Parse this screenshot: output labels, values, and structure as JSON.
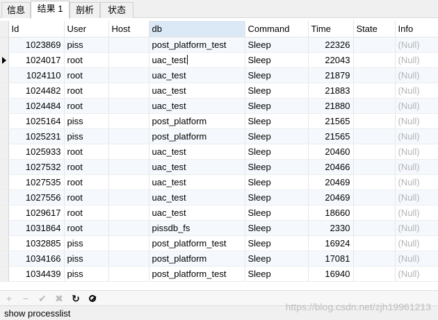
{
  "tabs": [
    {
      "label": "信息",
      "active": false
    },
    {
      "label": "结果 1",
      "active": true
    },
    {
      "label": "剖析",
      "active": false
    },
    {
      "label": "状态",
      "active": false
    }
  ],
  "grid": {
    "columns": [
      "Id",
      "User",
      "Host",
      "db",
      "Command",
      "Time",
      "State",
      "Info"
    ],
    "sorted_column": "db",
    "current_row_index": 1,
    "rows": [
      [
        "1023869",
        "piss",
        "",
        "post_platform_test",
        "Sleep",
        "22326",
        "",
        "(Null)"
      ],
      [
        "1024017",
        "root",
        "",
        "uac_test",
        "Sleep",
        "22043",
        "",
        "(Null)"
      ],
      [
        "1024110",
        "root",
        "",
        "uac_test",
        "Sleep",
        "21879",
        "",
        "(Null)"
      ],
      [
        "1024482",
        "root",
        "",
        "uac_test",
        "Sleep",
        "21883",
        "",
        "(Null)"
      ],
      [
        "1024484",
        "root",
        "",
        "uac_test",
        "Sleep",
        "21880",
        "",
        "(Null)"
      ],
      [
        "1025164",
        "piss",
        "",
        "post_platform",
        "Sleep",
        "21565",
        "",
        "(Null)"
      ],
      [
        "1025231",
        "piss",
        "",
        "post_platform",
        "Sleep",
        "21565",
        "",
        "(Null)"
      ],
      [
        "1025933",
        "root",
        "",
        "uac_test",
        "Sleep",
        "20460",
        "",
        "(Null)"
      ],
      [
        "1027532",
        "root",
        "",
        "uac_test",
        "Sleep",
        "20466",
        "",
        "(Null)"
      ],
      [
        "1027535",
        "root",
        "",
        "uac_test",
        "Sleep",
        "20469",
        "",
        "(Null)"
      ],
      [
        "1027556",
        "root",
        "",
        "uac_test",
        "Sleep",
        "20469",
        "",
        "(Null)"
      ],
      [
        "1029617",
        "root",
        "",
        "uac_test",
        "Sleep",
        "18660",
        "",
        "(Null)"
      ],
      [
        "1031864",
        "root",
        "",
        "pissdb_fs",
        "Sleep",
        "2330",
        "",
        "(Null)"
      ],
      [
        "1032885",
        "piss",
        "",
        "post_platform_test",
        "Sleep",
        "16924",
        "",
        "(Null)"
      ],
      [
        "1034166",
        "piss",
        "",
        "post_platform",
        "Sleep",
        "17081",
        "",
        "(Null)"
      ],
      [
        "1034439",
        "piss",
        "",
        "post_platform_test",
        "Sleep",
        "16940",
        "",
        "(Null)"
      ]
    ]
  },
  "toolbar": {
    "add": "+",
    "remove": "−",
    "apply": "✔",
    "discard": "✖",
    "refresh": "↻"
  },
  "status": {
    "sql": "show processlist",
    "watermark": "https://blog.csdn.net/zjh19961213"
  }
}
